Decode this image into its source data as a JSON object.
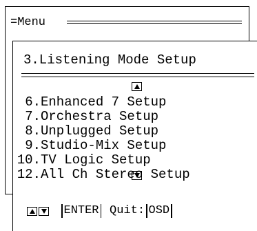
{
  "back_menu": {
    "title": "=Menu"
  },
  "front_menu": {
    "title": "3.Listening Mode Setup",
    "items": [
      {
        "number": "6.",
        "label": "Enhanced 7 Setup"
      },
      {
        "number": "7.",
        "label": "Orchestra Setup"
      },
      {
        "number": "8.",
        "label": "Unplugged Setup"
      },
      {
        "number": "9.",
        "label": "Studio-Mix Setup"
      },
      {
        "number": "10.",
        "label": "TV Logic Setup"
      },
      {
        "number": "12.",
        "label": "All Ch Stereo Setup"
      }
    ],
    "scroll_up_icon": "triangle-up-icon",
    "scroll_down_icon": "triangle-down-icon"
  },
  "footer": {
    "enter_label": "ENTER",
    "quit_label": "Quit:",
    "osd_label": "OSD"
  }
}
